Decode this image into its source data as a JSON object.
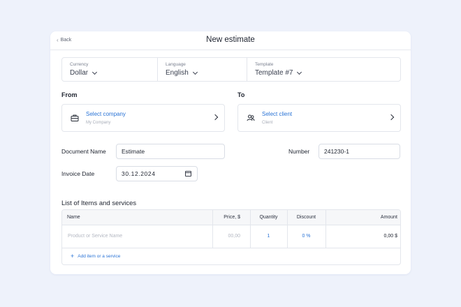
{
  "header": {
    "back_label": "Back",
    "title": "New estimate"
  },
  "settings": {
    "currency": {
      "label": "Currency",
      "value": "Dollar"
    },
    "language": {
      "label": "Language",
      "value": "English"
    },
    "template": {
      "label": "Template",
      "value": "Template #7"
    }
  },
  "from": {
    "heading": "From",
    "action": "Select company",
    "hint": "My Company",
    "icon": "briefcase-icon"
  },
  "to": {
    "heading": "To",
    "action": "Select client",
    "hint": "Client",
    "icon": "users-icon"
  },
  "document_name": {
    "label": "Document Name",
    "value": "Estimate"
  },
  "number": {
    "label": "Number",
    "value": "241230-1"
  },
  "invoice_date": {
    "label": "Invoice Date",
    "value": "30.12.2024",
    "icon": "calendar-icon"
  },
  "items": {
    "title": "List of Items and services",
    "columns": {
      "name": "Name",
      "price": "Price, $",
      "quantity": "Quantity",
      "discount": "Discount",
      "amount": "Amount"
    },
    "row": {
      "name_placeholder": "Product or Service Name",
      "price": "00,00",
      "quantity": "1",
      "discount": "0 %",
      "amount": "0,00 $"
    },
    "add_label": "Add item or a service"
  },
  "colors": {
    "accent": "#2b74d6",
    "background": "#eef2fb"
  }
}
